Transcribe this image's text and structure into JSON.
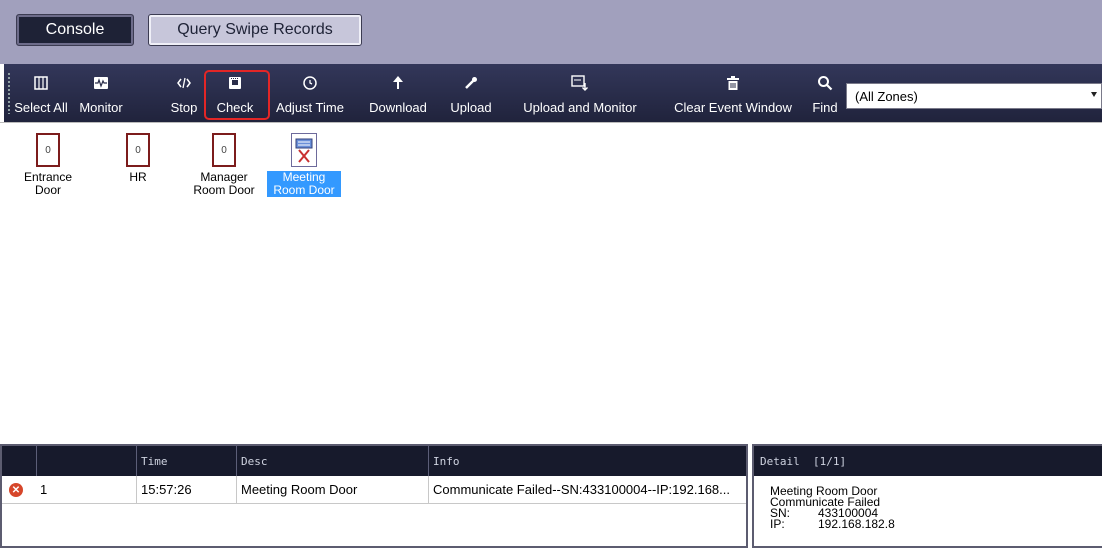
{
  "tabs": {
    "console": "Console",
    "query": "Query Swipe Records"
  },
  "toolbar": {
    "select_all": "Select All",
    "monitor": "Monitor",
    "stop": "Stop",
    "check": "Check",
    "adjust_time": "Adjust Time",
    "download": "Download",
    "upload": "Upload",
    "upload_monitor": "Upload and Monitor",
    "clear_event": "Clear Event Window",
    "find": "Find",
    "zone_selected": "(All Zones)"
  },
  "doors": [
    {
      "count": "0",
      "name": "Entrance Door"
    },
    {
      "count": "0",
      "name": "HR"
    },
    {
      "count": "0",
      "name": "Manager Room Door"
    },
    {
      "name": "Meeting Room Door"
    }
  ],
  "events": {
    "headers": {
      "time": "Time",
      "desc": "Desc",
      "info": "Info"
    },
    "rows": [
      {
        "index": "1",
        "time": "15:57:26",
        "desc": "Meeting Room Door",
        "info": "Communicate Failed--SN:433100004--IP:192.168..."
      }
    ]
  },
  "detail": {
    "header": "Detail  [1/1]",
    "door": "Meeting Room Door",
    "status": "Communicate Failed",
    "sn_label": "SN:",
    "sn": "433100004",
    "ip_label": "IP:",
    "ip": "192.168.182.8"
  },
  "colors": {
    "accent": "#e32626",
    "selection": "#3399ff",
    "toolbar": "#252942"
  },
  "icons": [
    "select-all-icon",
    "monitor-icon",
    "stop-icon",
    "check-icon",
    "clock-icon",
    "download-icon",
    "upload-icon",
    "upload-monitor-icon",
    "trash-icon",
    "find-icon",
    "error-icon"
  ]
}
